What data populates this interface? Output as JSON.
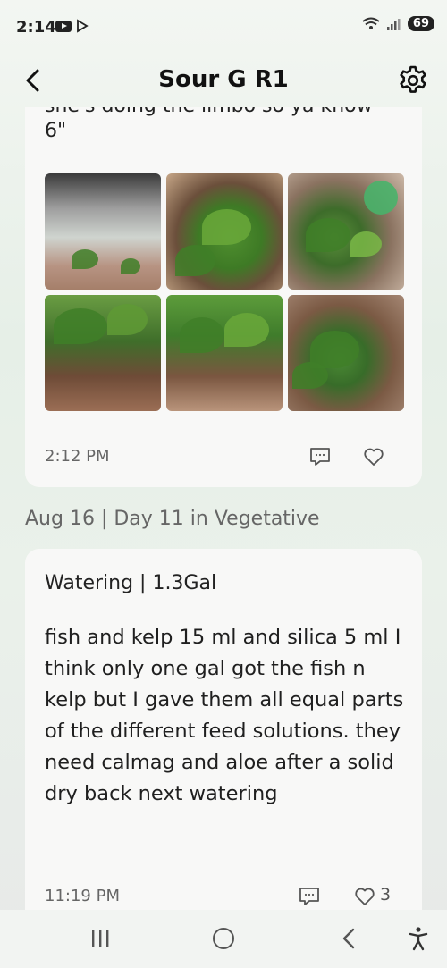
{
  "status_bar": {
    "time": "2:14",
    "battery": "69",
    "icons": [
      "youtube-icon",
      "play-store-icon",
      "wifi-icon",
      "signal-icon",
      "battery-icon"
    ]
  },
  "header": {
    "title": "Sour G R1",
    "back_icon": "chevron-left-icon",
    "settings_icon": "gear-icon"
  },
  "entries": [
    {
      "clipped_text_line1": "she's doing the limbo so ya know",
      "clipped_text_line2": "6\"",
      "photos": [
        "plant-photo-1",
        "plant-photo-2",
        "plant-photo-3",
        "plant-photo-4",
        "plant-photo-5",
        "plant-photo-6"
      ],
      "time": "2:12 PM",
      "likes": ""
    },
    {
      "date_label": "Aug 16 | Day 11 in Vegetative",
      "title": "Watering | 1.3Gal",
      "body": "fish and kelp 15 ml and silica 5 ml I think only one gal got the fish n kelp but I gave them all equal parts of the different feed solutions. they need calmag and aloe after a solid dry back next watering",
      "time": "11:19 PM",
      "likes": "3"
    }
  ],
  "nav": {
    "icons": [
      "recents-icon",
      "home-icon",
      "back-icon",
      "accessibility-icon"
    ]
  }
}
